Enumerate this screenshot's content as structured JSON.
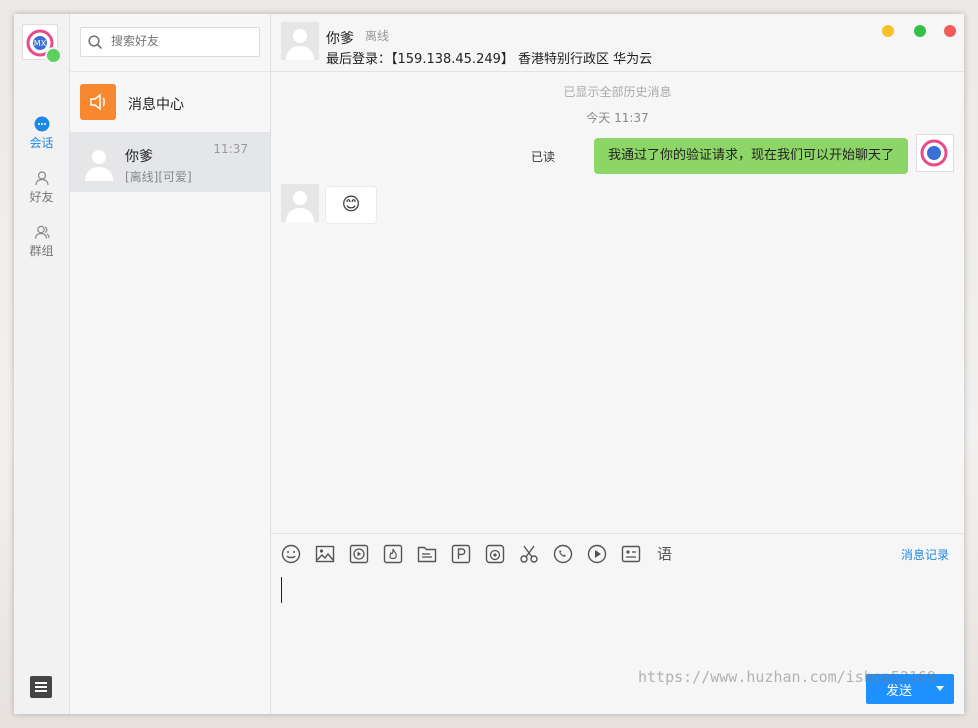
{
  "nav": {
    "items": [
      {
        "label": "会话",
        "icon": "chat-bubble-icon",
        "active": true
      },
      {
        "label": "好友",
        "icon": "person-icon",
        "active": false
      },
      {
        "label": "群组",
        "icon": "group-icon",
        "active": false
      }
    ],
    "me_avatar_text": "MX"
  },
  "search": {
    "placeholder": "搜索好友"
  },
  "message_center": {
    "label": "消息中心"
  },
  "conversations": [
    {
      "name": "你爹",
      "time": "11:37",
      "subtitle": "[离线][可爱]"
    }
  ],
  "chat_header": {
    "name": "你爹",
    "status": "离线",
    "last_login": "最后登录：【159.138.45.249】 香港特别行政区 华为云"
  },
  "messages": {
    "history_hint": "已显示全部历史消息",
    "time_hint": "今天 11:37",
    "outgoing": {
      "read_label": "已读",
      "text": "我通过了你的验证请求，现在我们可以开始聊天了"
    },
    "incoming": {
      "text": "😊"
    }
  },
  "composer": {
    "tools": [
      "emoji-icon",
      "image-icon",
      "video-icon",
      "fire-icon",
      "file-icon",
      "parking-icon",
      "camera-icon",
      "scissors-icon",
      "phone-icon",
      "play-icon",
      "card-icon",
      "voice-icon"
    ],
    "voice_glyph": "语",
    "history_link": "消息记录",
    "send_label": "发送"
  },
  "watermark": "https://www.huzhan.com/ishop52169",
  "colors": {
    "accent": "#1e88e5",
    "bubble_me": "#8ed567",
    "message_center": "#f7882f",
    "send": "#1e90ff"
  }
}
